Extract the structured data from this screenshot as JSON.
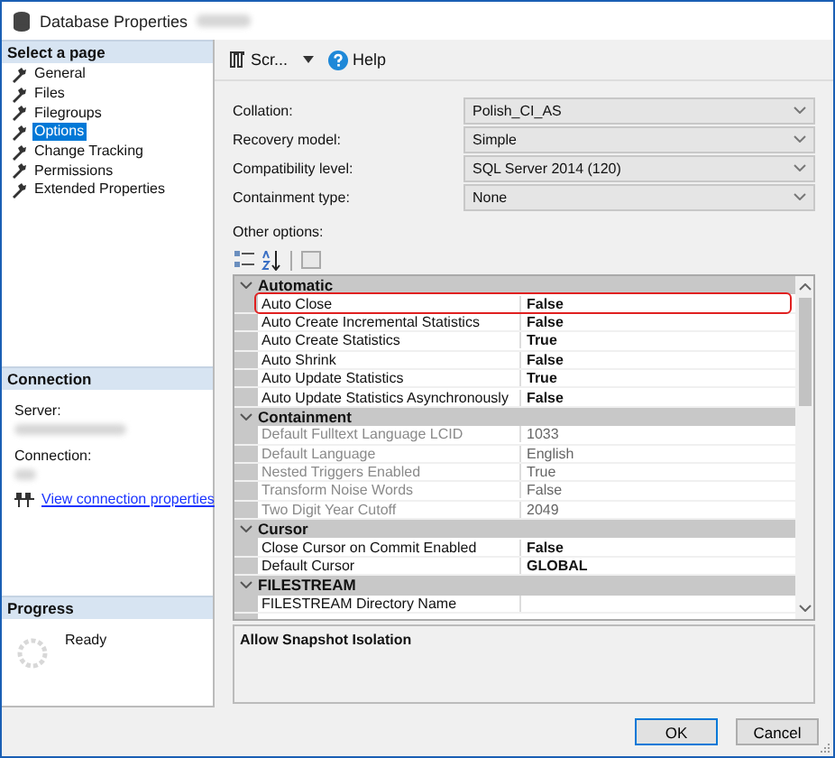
{
  "window": {
    "title": "Database Properties"
  },
  "sidebar": {
    "header": "Select a page",
    "items": [
      {
        "label": "General",
        "selected": false
      },
      {
        "label": "Files",
        "selected": false
      },
      {
        "label": "Filegroups",
        "selected": false
      },
      {
        "label": "Options",
        "selected": true
      },
      {
        "label": "Change Tracking",
        "selected": false
      },
      {
        "label": "Permissions",
        "selected": false
      },
      {
        "label": "Extended Properties",
        "selected": false
      }
    ]
  },
  "connection": {
    "header": "Connection",
    "server_label": "Server:",
    "connection_label": "Connection:",
    "link": "View connection properties"
  },
  "progress": {
    "header": "Progress",
    "status": "Ready"
  },
  "toolbar": {
    "script": "Scr...",
    "help": "Help"
  },
  "fields": [
    {
      "label": "Collation:",
      "value": "Polish_CI_AS"
    },
    {
      "label": "Recovery model:",
      "value": "Simple"
    },
    {
      "label": "Compatibility level:",
      "value": "SQL Server 2014 (120)"
    },
    {
      "label": "Containment type:",
      "value": "None"
    }
  ],
  "other_options_label": "Other options:",
  "property_grid": {
    "categories": [
      {
        "name": "Automatic",
        "expanded": true,
        "rows": [
          {
            "name": "Auto Close",
            "value": "False",
            "disabled": false,
            "highlighted": true
          },
          {
            "name": "Auto Create Incremental Statistics",
            "value": "False",
            "disabled": false,
            "highlighted": false
          },
          {
            "name": "Auto Create Statistics",
            "value": "True",
            "disabled": false,
            "highlighted": false
          },
          {
            "name": "Auto Shrink",
            "value": "False",
            "disabled": false,
            "highlighted": false
          },
          {
            "name": "Auto Update Statistics",
            "value": "True",
            "disabled": false,
            "highlighted": false
          },
          {
            "name": "Auto Update Statistics Asynchronously",
            "value": "False",
            "disabled": false,
            "highlighted": false
          }
        ]
      },
      {
        "name": "Containment",
        "expanded": true,
        "rows": [
          {
            "name": "Default Fulltext Language LCID",
            "value": "1033",
            "disabled": true,
            "highlighted": false
          },
          {
            "name": "Default Language",
            "value": "English",
            "disabled": true,
            "highlighted": false
          },
          {
            "name": "Nested Triggers Enabled",
            "value": "True",
            "disabled": true,
            "highlighted": false
          },
          {
            "name": "Transform Noise Words",
            "value": "False",
            "disabled": true,
            "highlighted": false
          },
          {
            "name": "Two Digit Year Cutoff",
            "value": "2049",
            "disabled": true,
            "highlighted": false
          }
        ]
      },
      {
        "name": "Cursor",
        "expanded": true,
        "rows": [
          {
            "name": "Close Cursor on Commit Enabled",
            "value": "False",
            "disabled": false,
            "highlighted": false
          },
          {
            "name": "Default Cursor",
            "value": "GLOBAL",
            "disabled": false,
            "highlighted": false
          }
        ]
      },
      {
        "name": "FILESTREAM",
        "expanded": true,
        "rows": [
          {
            "name": "FILESTREAM Directory Name",
            "disabled": false,
            "highlighted": false
          }
        ]
      }
    ]
  },
  "description": "Allow Snapshot Isolation",
  "buttons": [
    {
      "label": "OK",
      "default": true
    },
    {
      "label": "Cancel",
      "default": false
    }
  ]
}
